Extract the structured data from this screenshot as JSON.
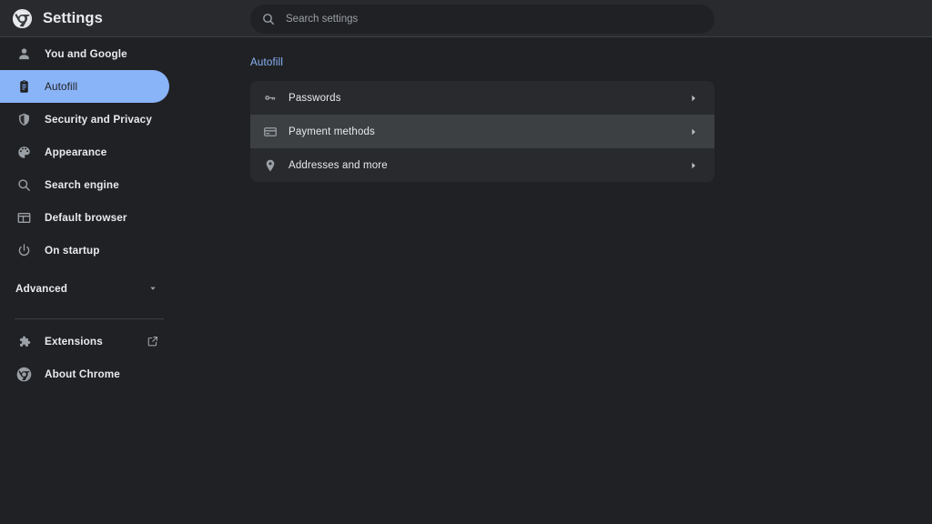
{
  "header": {
    "title": "Settings",
    "logo_icon": "chrome-logo-icon",
    "search": {
      "icon": "search-icon",
      "placeholder": "Search settings",
      "value": ""
    }
  },
  "sidebar": {
    "items": [
      {
        "label": "You and Google",
        "icon": "person-icon",
        "selected": false
      },
      {
        "label": "Autofill",
        "icon": "clipboard-icon",
        "selected": true
      },
      {
        "label": "Security and Privacy",
        "icon": "shield-icon",
        "selected": false
      },
      {
        "label": "Appearance",
        "icon": "palette-icon",
        "selected": false
      },
      {
        "label": "Search engine",
        "icon": "magnifier-icon",
        "selected": false
      },
      {
        "label": "Default browser",
        "icon": "browser-window-icon",
        "selected": false
      },
      {
        "label": "On startup",
        "icon": "power-icon",
        "selected": false
      }
    ],
    "advanced": {
      "label": "Advanced",
      "icon": "chevron-down-icon",
      "expanded": false
    },
    "footer_items": [
      {
        "label": "Extensions",
        "icon": "puzzle-piece-icon",
        "trailing_icon": "external-link-icon"
      },
      {
        "label": "About Chrome",
        "icon": "chrome-logo-icon",
        "trailing_icon": ""
      }
    ]
  },
  "main": {
    "section_heading": "Autofill",
    "rows": [
      {
        "label": "Passwords",
        "icon": "key-icon",
        "arrow": "chevron-right-icon",
        "hovered": false
      },
      {
        "label": "Payment methods",
        "icon": "credit-card-icon",
        "arrow": "chevron-right-icon",
        "hovered": true
      },
      {
        "label": "Addresses and more",
        "icon": "location-pin-icon",
        "arrow": "chevron-right-icon",
        "hovered": false
      }
    ]
  },
  "colors": {
    "accent": "#8ab4f8",
    "header_bg": "#292a2d",
    "body_bg": "#202124",
    "card_bg": "#292a2d",
    "row_hover_bg": "#3c4043",
    "text_primary": "#e8eaed",
    "text_secondary": "#9aa0a6"
  }
}
